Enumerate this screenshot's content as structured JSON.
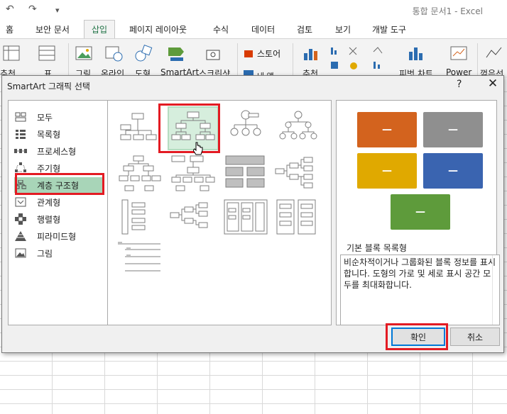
{
  "window": {
    "title": "통합 문서1 - Excel",
    "quick_access": [
      "↶",
      "↷",
      "▾"
    ]
  },
  "ribbon_tabs": [
    {
      "label": "홈",
      "active": false
    },
    {
      "label": "보안 문서",
      "active": false
    },
    {
      "label": "삽입",
      "active": true
    },
    {
      "label": "페이지 레이아웃",
      "active": false
    },
    {
      "label": "수식",
      "active": false
    },
    {
      "label": "데이터",
      "active": false
    },
    {
      "label": "검토",
      "active": false
    },
    {
      "label": "보기",
      "active": false
    },
    {
      "label": "개발 도구",
      "active": false
    }
  ],
  "ribbon_buttons": [
    {
      "label": "추천",
      "icon": "pivot-table-icon"
    },
    {
      "label": "표",
      "icon": "table-icon"
    },
    {
      "label": "그림",
      "icon": "picture-icon"
    },
    {
      "label": "온라인",
      "icon": "online-picture-icon"
    },
    {
      "label": "도형",
      "icon": "shapes-icon"
    },
    {
      "label": "SmartArt",
      "icon": "smartart-icon"
    },
    {
      "label": "스크린샷",
      "icon": "screenshot-icon"
    },
    {
      "label": "스토어",
      "icon": "store-icon"
    },
    {
      "label": "내 앱",
      "icon": "my-apps-icon"
    },
    {
      "label": "추천",
      "icon": "recommended-chart-icon"
    },
    {
      "label": "피벗 차트",
      "icon": "pivot-chart-icon"
    },
    {
      "label": "Power",
      "icon": "power-view-icon"
    },
    {
      "label": "꺾은선",
      "icon": "line-sparkline-icon"
    }
  ],
  "dialog": {
    "title": "SmartArt 그래픽 선택",
    "help": "?",
    "close": "✕",
    "categories": [
      {
        "label": "모두",
        "icon": "all-icon"
      },
      {
        "label": "목록형",
        "icon": "list-icon"
      },
      {
        "label": "프로세스형",
        "icon": "process-icon"
      },
      {
        "label": "주기형",
        "icon": "cycle-icon"
      },
      {
        "label": "계층 구조형",
        "icon": "hierarchy-icon",
        "selected": true
      },
      {
        "label": "관계형",
        "icon": "relationship-icon"
      },
      {
        "label": "행렬형",
        "icon": "matrix-icon"
      },
      {
        "label": "피라미드형",
        "icon": "pyramid-icon"
      },
      {
        "label": "그림",
        "icon": "picture-icon"
      }
    ],
    "selected_layout": "기본 블록 목록형",
    "description": "비순차적이거나 그룹화된 블록 정보를 표시합니다. 도형의 가로 및 세로 표시 공간 모두를 최대화합니다.",
    "preview_blocks": [
      {
        "label": "—",
        "color": "#d3631e"
      },
      {
        "label": "—",
        "color": "#8f8f8f"
      },
      {
        "label": "—",
        "color": "#e0a900"
      },
      {
        "label": "—",
        "color": "#3a64b0"
      },
      {
        "label": "—",
        "color": "#5e9b3b"
      }
    ],
    "ok_label": "확인",
    "cancel_label": "취소"
  },
  "colors": {
    "excel_green": "#217346",
    "highlight_red": "#e31b23",
    "selected_category_bg": "#a8d5b8"
  }
}
